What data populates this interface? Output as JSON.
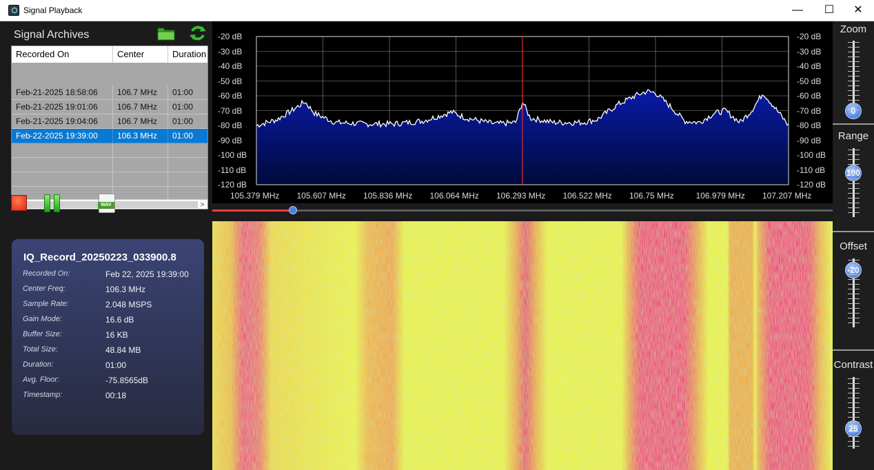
{
  "window": {
    "title": "Signal Playback",
    "controls": [
      "—",
      "☐",
      "✕"
    ]
  },
  "archives": {
    "title": "Signal Archives",
    "columns": [
      "Recorded On",
      "Center",
      "Duration"
    ],
    "rows": [
      {
        "recorded": "Feb-21-2025 18:58:06",
        "center": "106.7 MHz",
        "duration": "01:00"
      },
      {
        "recorded": "Feb-21-2025 19:01:06",
        "center": "106.7 MHz",
        "duration": "01:00"
      },
      {
        "recorded": "Feb-21-2025 19:04:06",
        "center": "106.7 MHz",
        "duration": "01:00"
      },
      {
        "recorded": "Feb-22-2025 19:39:00",
        "center": "106.3 MHz",
        "duration": "01:00"
      }
    ],
    "selected_row": 3,
    "wav_label": "WAV"
  },
  "info": {
    "filename": "IQ_Record_20250223_033900.8",
    "fields": [
      {
        "key": "Recorded On:",
        "value": "Feb 22, 2025 19:39:00"
      },
      {
        "key": "Center Freq:",
        "value": "106.3 MHz"
      },
      {
        "key": "Sample Rate:",
        "value": "2.048 MSPS"
      },
      {
        "key": "Gain Mode:",
        "value": "16.6 dB"
      },
      {
        "key": "Buffer Size:",
        "value": "16 KB"
      },
      {
        "key": "Total Size:",
        "value": "48.84 MB"
      },
      {
        "key": "Duration:",
        "value": "01:00"
      },
      {
        "key": "Avg. Floor:",
        "value": "-75.8565dB"
      },
      {
        "key": "Timestamp:",
        "value": "00:18"
      }
    ]
  },
  "spectrum": {
    "db_labels": [
      "-20 dB",
      "-30 dB",
      "-40 dB",
      "-50 dB",
      "-60 dB",
      "-70 dB",
      "-80 dB",
      "-90 dB",
      "-100 dB",
      "-110 dB",
      "-120 dB"
    ],
    "freq_labels": [
      "105.379 MHz",
      "105.607 MHz",
      "105.836 MHz",
      "106.064 MHz",
      "106.293 MHz",
      "106.522 MHz",
      "106.75 MHz",
      "106.979 MHz",
      "107.207 MHz"
    ],
    "colors": {
      "fill": "#0a1aa8",
      "trace": "#ffffff",
      "marker": "#e03030",
      "grid": "#cfcfcf"
    }
  },
  "chart_data": {
    "type": "area",
    "x_range_mhz": [
      105.379,
      107.207
    ],
    "ylim": [
      -120,
      -20
    ],
    "grid": true,
    "x": [
      105.379,
      105.45,
      105.5,
      105.5454,
      105.58,
      105.65,
      105.75,
      105.85,
      105.95,
      106.0,
      106.05,
      106.1,
      106.2,
      106.27,
      106.293,
      106.32,
      106.4,
      106.5,
      106.55,
      106.62,
      106.68,
      106.72,
      106.75,
      106.8,
      106.85,
      106.9,
      106.95,
      106.99,
      107.04,
      107.08,
      107.12,
      107.16,
      107.207
    ],
    "y": [
      -80,
      -76,
      -70,
      -64,
      -72,
      -78,
      -79,
      -79,
      -77,
      -74,
      -71,
      -75,
      -79,
      -78,
      -64,
      -75,
      -78,
      -78,
      -76,
      -66,
      -60,
      -57,
      -58,
      -67,
      -77,
      -78,
      -72,
      -70,
      -78,
      -70,
      -58,
      -68,
      -80
    ],
    "playback_progress": 0.13
  },
  "controls": [
    {
      "label": "Zoom",
      "value": "0"
    },
    {
      "label": "Range",
      "value": "100"
    },
    {
      "label": "Offset",
      "value": "-20"
    },
    {
      "label": "Contrast",
      "value": "25"
    }
  ]
}
